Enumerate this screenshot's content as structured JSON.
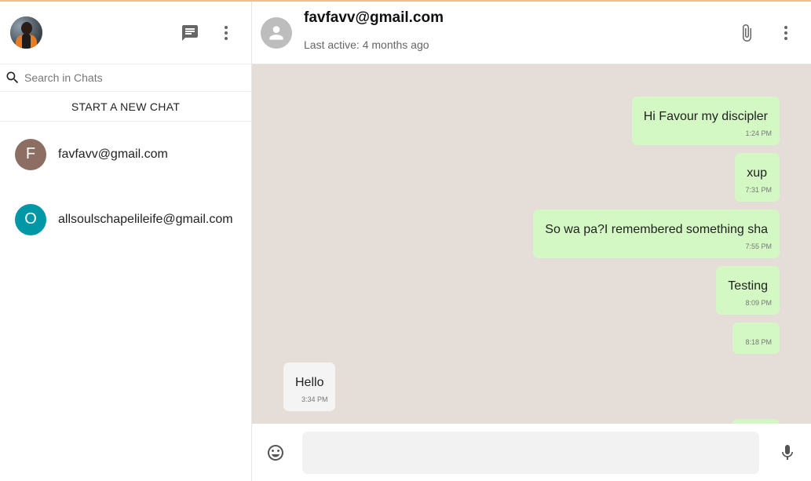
{
  "sidebar": {
    "search": {
      "placeholder": "Search in Chats"
    },
    "start_chat_label": "START A NEW CHAT",
    "chats": [
      {
        "initial": "F",
        "name": "favfavv@gmail.com",
        "color": "#8d6e63"
      },
      {
        "initial": "O",
        "name": "allsoulschapelileife@gmail.com",
        "color": "#0097a7"
      }
    ]
  },
  "header": {
    "name": "favfavv@gmail.com",
    "status": "Last active: 4 months ago"
  },
  "messages": [
    {
      "direction": "out",
      "text": "Hi Favour my discipler",
      "time": "1:24 PM"
    },
    {
      "direction": "out",
      "text": "xup",
      "time": "7:31 PM"
    },
    {
      "direction": "out",
      "text": "So wa pa?I remembered something sha",
      "time": "7:55 PM"
    },
    {
      "direction": "out",
      "text": "Testing",
      "time": "8:09 PM"
    },
    {
      "direction": "out",
      "text": "",
      "time": "8:18 PM"
    },
    {
      "direction": "in",
      "text": "Hello",
      "time": "3:34 PM"
    }
  ],
  "composer": {
    "placeholder": ""
  },
  "colors": {
    "chat_background": "#e5ded8",
    "outgoing_bubble": "#d4f8c4",
    "incoming_bubble": "#f4f4f4",
    "top_accent": "#f0c089"
  },
  "icons": {
    "new_chat": "chat-icon",
    "sidebar_menu": "more-vert-icon",
    "search": "search-icon",
    "attach": "paperclip-icon",
    "chat_menu": "more-vert-icon",
    "emoji": "emoji-icon",
    "mic": "mic-icon"
  }
}
